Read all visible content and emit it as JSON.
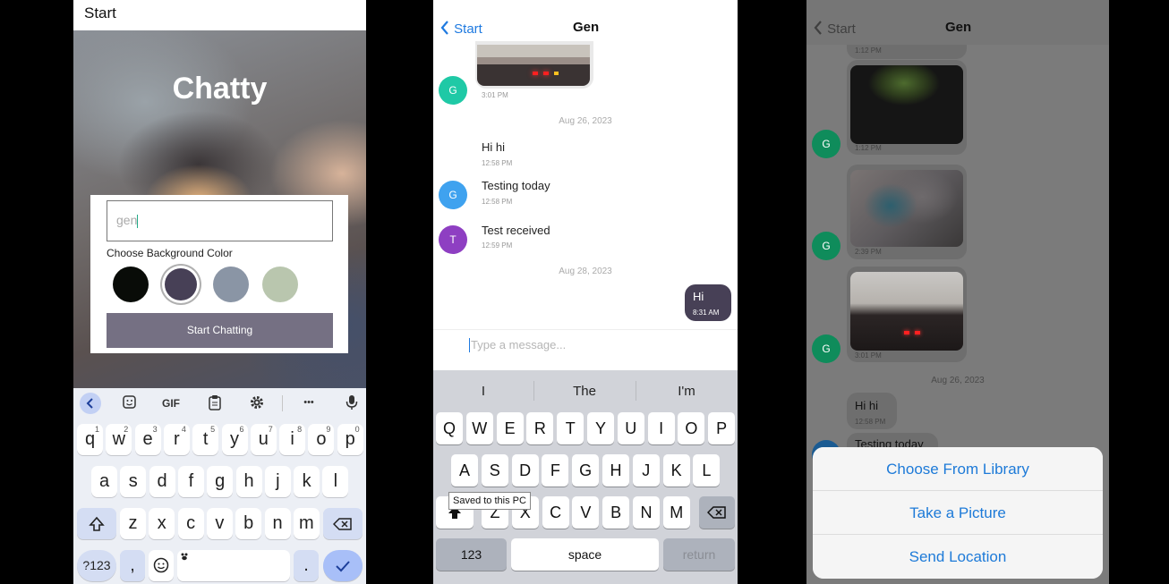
{
  "screen1": {
    "header_title": "Start",
    "app_title": "Chatty",
    "name_input_value": "gen",
    "choose_color_label": "Choose Background Color",
    "colors": [
      "#090C08",
      "#474056",
      "#8A95A5",
      "#B9C6AE"
    ],
    "selected_color_index": 1,
    "start_button_label": "Start Chatting",
    "keyboard": {
      "toolbar": [
        "GIF",
        "•••"
      ],
      "row1": [
        "q",
        "w",
        "e",
        "r",
        "t",
        "y",
        "u",
        "i",
        "o",
        "p"
      ],
      "row1_hints": [
        "1",
        "2",
        "3",
        "4",
        "5",
        "6",
        "7",
        "8",
        "9",
        "0"
      ],
      "row2": [
        "a",
        "s",
        "d",
        "f",
        "g",
        "h",
        "j",
        "k",
        "l"
      ],
      "row3": [
        "z",
        "x",
        "c",
        "v",
        "b",
        "n",
        "m"
      ],
      "symbols_key": "?123",
      "comma_key": ",",
      "period_key": "."
    }
  },
  "screen2": {
    "back_label": "Start",
    "title": "Gen",
    "messages": [
      {
        "time": "3:01 PM",
        "avatar": "G",
        "avatar_color": "#1fc9a6"
      },
      {
        "date": "Aug 26, 2023"
      },
      {
        "text": "Hi hi",
        "time": "12:58 PM"
      },
      {
        "text": "Testing today",
        "time": "12:58 PM",
        "avatar": "G",
        "avatar_color": "#3fa2ef"
      },
      {
        "text": "Test received",
        "time": "12:59 PM",
        "avatar": "T",
        "avatar_color": "#8e3fc2"
      },
      {
        "date": "Aug 28, 2023"
      },
      {
        "text": "Hi",
        "time": "8:31 AM"
      }
    ],
    "input_placeholder": "Type a message...",
    "suggestions": [
      "I",
      "The",
      "I'm"
    ],
    "keyboard": {
      "row1": [
        "Q",
        "W",
        "E",
        "R",
        "T",
        "Y",
        "U",
        "I",
        "O",
        "P"
      ],
      "row2": [
        "A",
        "S",
        "D",
        "F",
        "G",
        "H",
        "J",
        "K",
        "L"
      ],
      "row3": [
        "Z",
        "X",
        "C",
        "V",
        "B",
        "N",
        "M"
      ],
      "numbers_key": "123",
      "space_key": "space",
      "return_key": "return"
    },
    "tooltip": "Saved to this PC"
  },
  "screen3": {
    "back_label": "Start",
    "title": "Gen",
    "times": [
      "1:12 PM",
      "1:12 PM",
      "2:39 PM",
      "3:01 PM",
      "12:58 PM"
    ],
    "avatar": "G",
    "date_sep": "Aug 26, 2023",
    "msg_hi": "Hi hi",
    "msg_testing": "Testing today",
    "sheet": [
      "Choose From Library",
      "Take a Picture",
      "Send Location"
    ]
  }
}
